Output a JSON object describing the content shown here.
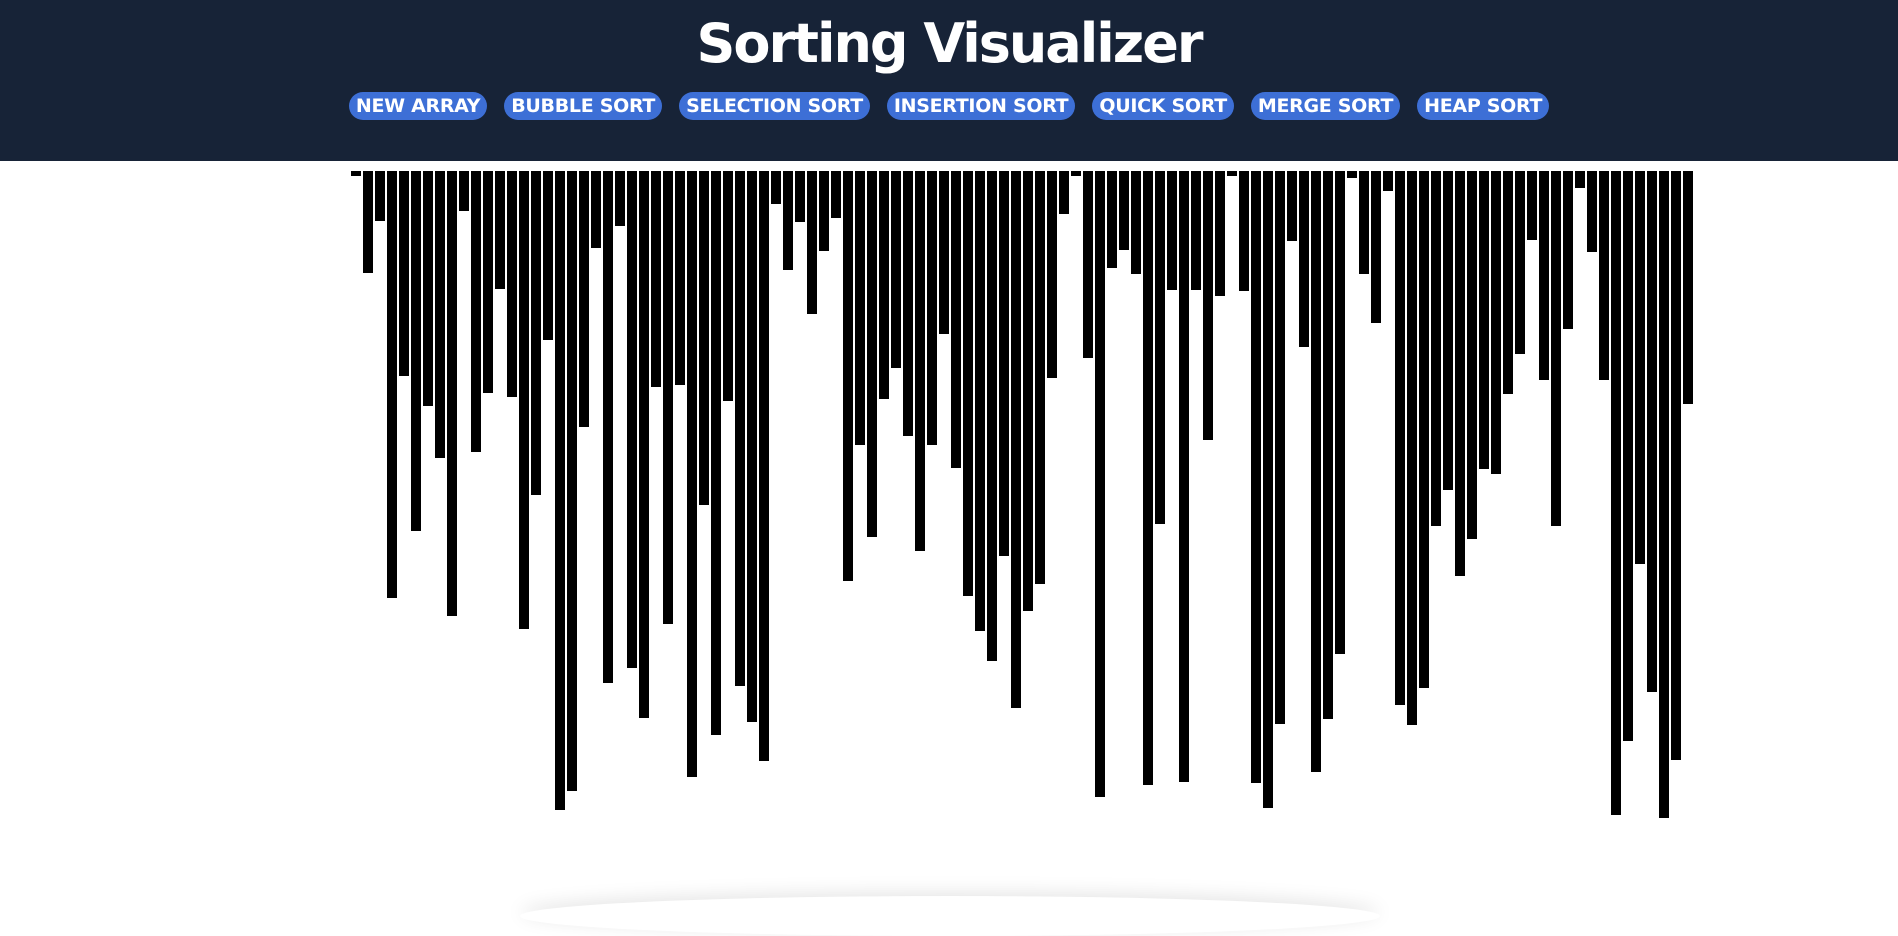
{
  "app": {
    "title": "Sorting Visualizer"
  },
  "toolbar": {
    "buttons": [
      {
        "label": "NEW ARRAY"
      },
      {
        "label": "BUBBLE SORT"
      },
      {
        "label": "SELECTION SORT"
      },
      {
        "label": "INSERTION SORT"
      },
      {
        "label": "QUICK SORT"
      },
      {
        "label": "MERGE SORT"
      },
      {
        "label": "HEAP SORT"
      }
    ]
  },
  "colors": {
    "header_bg": "#172337",
    "button_bg": "#3d6fd6",
    "bar": "#000000"
  },
  "array": {
    "max_value": 650,
    "values": [
      5,
      102,
      50,
      427,
      205,
      360,
      235,
      287,
      445,
      40,
      281,
      222,
      118,
      226,
      458,
      324,
      169,
      639,
      620,
      256,
      77,
      512,
      55,
      497,
      547,
      216,
      453,
      214,
      606,
      334,
      564,
      230,
      515,
      551,
      590,
      33,
      99,
      51,
      143,
      80,
      47,
      410,
      274,
      366,
      228,
      197,
      265,
      380,
      274,
      163,
      297,
      425,
      460,
      490,
      385,
      537,
      440,
      413,
      207,
      43,
      5,
      187,
      626,
      97,
      79,
      103,
      614,
      353,
      119,
      611,
      119,
      269,
      125,
      5,
      120,
      612,
      637,
      553,
      70,
      176,
      601,
      548,
      483,
      7,
      103,
      152,
      20,
      534,
      554,
      517,
      355,
      319,
      405,
      368,
      298,
      303,
      223,
      183,
      69,
      209,
      355,
      158,
      17,
      81,
      209,
      644,
      570,
      393,
      521,
      647,
      589,
      233
    ]
  }
}
